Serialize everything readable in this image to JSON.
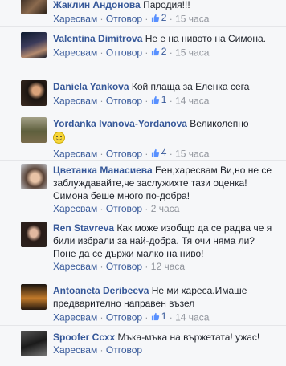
{
  "labels": {
    "like": "Харесвам",
    "reply": "Отговор",
    "dot": "·"
  },
  "comments": [
    {
      "author": "Жаклин Андонова",
      "text": "Пародия!!!",
      "likes": "2",
      "time": "15 часа"
    },
    {
      "author": "Valentina Dimitrova",
      "text": "Не е на нивото на Симона.",
      "likes": "2",
      "time": "15 часа"
    },
    {
      "author": "Daniela Yankova",
      "text": "Кой плаща за Еленка сега",
      "likes": "1",
      "time": "14 часа"
    },
    {
      "author": "Yordanka Ivanova-Yordanova",
      "text": "Великолепно",
      "likes": "4",
      "time": "15 часа"
    },
    {
      "author": "Цветанка Манасиева",
      "text": "Еен,харесвам Ви,но не се заблуждавайте,че заслужихте тази оценка! Симона беше много по-добра!",
      "likes": "",
      "time": "2 часа"
    },
    {
      "author": "Ren Stavreva",
      "text": "Как може изобщо да се радва че я били избрали за най-добра. Тя очи няма ли? Поне да се държи малко на ниво!",
      "likes": "",
      "time": "12 часа"
    },
    {
      "author": "Antoaneta Deribeeva",
      "text": "Не ми хареса.Имаше предварително направен възел",
      "likes": "1",
      "time": "14 часа"
    },
    {
      "author": "Spoofer Cсхх",
      "text": "Мъка-мъка на вържетата! ужас!",
      "likes": "",
      "time": ""
    }
  ],
  "colors": {
    "link": "#365899",
    "meta": "#90949c",
    "text": "#1d2129",
    "bg": "#f6f7f9"
  },
  "icons": [
    "thumbs-up-icon",
    "smile-emoji-icon"
  ]
}
